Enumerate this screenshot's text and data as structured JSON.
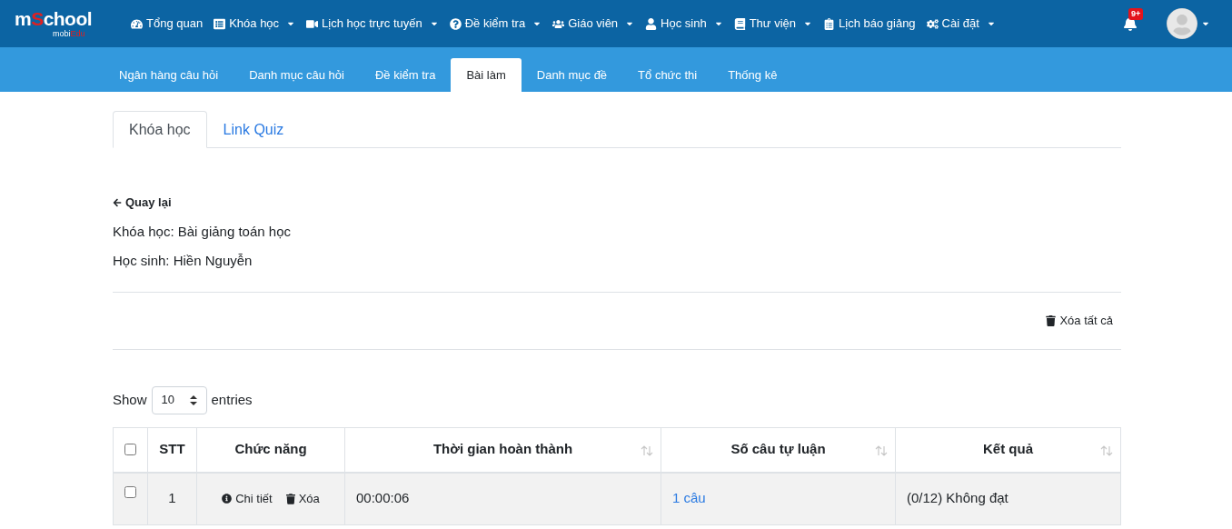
{
  "logo": {
    "parts": [
      "m",
      "S",
      "chool"
    ],
    "sub_parts": [
      "mobi",
      "Edu"
    ]
  },
  "nav": [
    {
      "label": "Tổng quan",
      "dropdown": false
    },
    {
      "label": "Khóa học",
      "dropdown": true
    },
    {
      "label": "Lịch học trực tuyến",
      "dropdown": true
    },
    {
      "label": "Đề kiểm tra",
      "dropdown": true
    },
    {
      "label": "Giáo viên",
      "dropdown": true
    },
    {
      "label": "Học sinh",
      "dropdown": true
    },
    {
      "label": "Thư viện",
      "dropdown": true
    },
    {
      "label": "Lịch báo giảng",
      "dropdown": false
    },
    {
      "label": "Cài đặt",
      "dropdown": true
    }
  ],
  "notifications": {
    "badge": "9+"
  },
  "subnav": [
    {
      "label": "Ngân hàng câu hỏi",
      "selected": false
    },
    {
      "label": "Danh mục câu hỏi",
      "selected": false
    },
    {
      "label": "Đề kiểm tra",
      "selected": false
    },
    {
      "label": "Bài làm",
      "selected": true
    },
    {
      "label": "Danh mục đề",
      "selected": false
    },
    {
      "label": "Tổ chức thi",
      "selected": false
    },
    {
      "label": "Thống kê",
      "selected": false
    }
  ],
  "tabs": [
    {
      "label": "Khóa học",
      "selected": true
    },
    {
      "label": "Link Quiz",
      "selected": false
    }
  ],
  "back_link": "Quay lại",
  "info": [
    "Khóa học: Bài giảng toán học",
    "Học sinh: Hiền Nguyễn"
  ],
  "delete_all": "Xóa tất cả",
  "length": {
    "prefix": "Show",
    "value": "10",
    "suffix": "entries"
  },
  "table": {
    "select_all_checked": false,
    "columns": [
      {
        "label": "STT",
        "sortable": false
      },
      {
        "label": "Chức năng",
        "sortable": false
      },
      {
        "label": "Thời gian hoàn thành",
        "sortable": true
      },
      {
        "label": "Số câu tự luận",
        "sortable": true
      },
      {
        "label": "Kết quả",
        "sortable": true
      }
    ],
    "rows": [
      {
        "checked": false,
        "stt": "1",
        "actions": [
          "Chi tiết",
          "Xóa"
        ],
        "time": "00:00:06",
        "essay": "1 câu",
        "result": "(0/12) Không đạt"
      }
    ]
  }
}
